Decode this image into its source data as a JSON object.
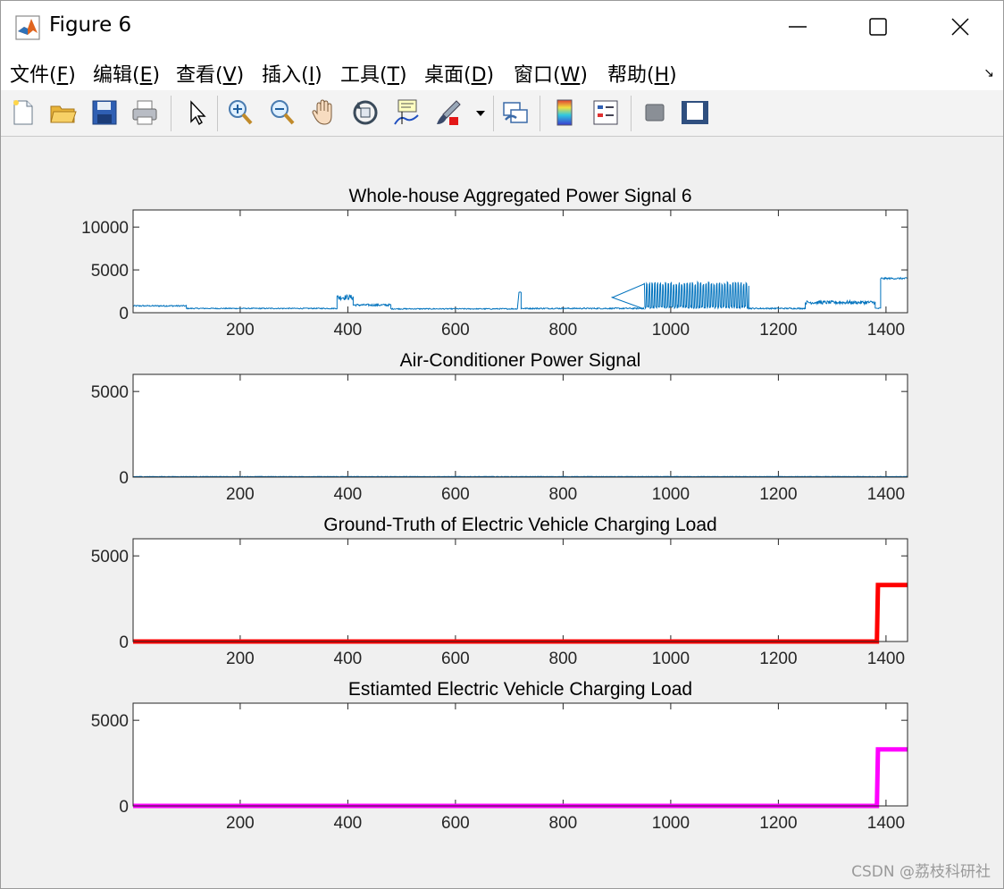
{
  "window": {
    "title": "Figure 6"
  },
  "menu": [
    {
      "label": "文件(",
      "key": "F",
      "tail": ")"
    },
    {
      "label": "编辑(",
      "key": "E",
      "tail": ")"
    },
    {
      "label": "查看(",
      "key": "V",
      "tail": ")"
    },
    {
      "label": "插入(",
      "key": "I",
      "tail": ")"
    },
    {
      "label": "工具(",
      "key": "T",
      "tail": ")"
    },
    {
      "label": "桌面(",
      "key": "D",
      "tail": ")"
    },
    {
      "label": "窗口(",
      "key": "W",
      "tail": ")"
    },
    {
      "label": "帮助(",
      "key": "H",
      "tail": ")"
    }
  ],
  "toolbar": {
    "icons": [
      "new-figure-icon",
      "open-file-icon",
      "save-icon",
      "print-icon",
      "select-arrow-icon",
      "zoom-in-icon",
      "zoom-out-icon",
      "pan-hand-icon",
      "rotate-3d-icon",
      "data-cursor-icon",
      "brush-icon",
      "brush-dropdown-icon",
      "link-plot-icon",
      "colorbar-icon",
      "legend-icon",
      "hide-plot-tools-icon",
      "show-plot-tools-icon"
    ]
  },
  "colors": {
    "aggregate": "#0072BD",
    "ac": "#0072BD",
    "ground_truth": "#FF0000",
    "estimated": "#FF00FF"
  },
  "watermark": "CSDN @荔枝科研社",
  "chart_data": [
    {
      "type": "line",
      "title": "Whole-house Aggregated Power Signal 6",
      "xlim": [
        1,
        1440
      ],
      "ylim": [
        0,
        12000
      ],
      "xticks": [
        200,
        400,
        600,
        800,
        1000,
        1200,
        1400
      ],
      "yticks": [
        0,
        5000,
        10000
      ],
      "series": [
        {
          "color": "#0072BD",
          "segments": [
            {
              "x": [
                1,
                100
              ],
              "base": 800,
              "noise": 150
            },
            {
              "x": [
                100,
                380
              ],
              "base": 500,
              "noise": 120
            },
            {
              "x": [
                380,
                410
              ],
              "base": 1800,
              "noise": 600
            },
            {
              "x": [
                410,
                480
              ],
              "base": 900,
              "noise": 250
            },
            {
              "x": [
                480,
                715
              ],
              "base": 450,
              "noise": 120
            },
            {
              "x": [
                718,
                722
              ],
              "base": 2400,
              "noise": 100
            },
            {
              "x": [
                722,
                950
              ],
              "base": 500,
              "noise": 150
            },
            {
              "x": [
                890,
                893
              ],
              "base": 1800,
              "noise": 100
            },
            {
              "x": [
                950,
                1145
              ],
              "base": 2500,
              "noise": 1000,
              "spiky": true
            },
            {
              "x": [
                1145,
                1250
              ],
              "base": 500,
              "noise": 150
            },
            {
              "x": [
                1250,
                1380
              ],
              "base": 1200,
              "noise": 400
            },
            {
              "x": [
                1380,
                1390
              ],
              "base": 500,
              "noise": 150
            },
            {
              "x": [
                1390,
                1440
              ],
              "base": 4000,
              "noise": 200
            }
          ]
        }
      ]
    },
    {
      "type": "line",
      "title": "Air-Conditioner Power Signal",
      "xlim": [
        1,
        1440
      ],
      "ylim": [
        0,
        6000
      ],
      "xticks": [
        200,
        400,
        600,
        800,
        1000,
        1200,
        1400
      ],
      "yticks": [
        0,
        5000
      ],
      "series": [
        {
          "color": "#0072BD",
          "segments": [
            {
              "x": [
                1,
                1440
              ],
              "base": 30,
              "noise": 25
            }
          ]
        }
      ]
    },
    {
      "type": "line",
      "title": "Ground-Truth of Electric Vehicle Charging Load",
      "xlim": [
        1,
        1440
      ],
      "ylim": [
        0,
        6000
      ],
      "xticks": [
        200,
        400,
        600,
        800,
        1000,
        1200,
        1400
      ],
      "yticks": [
        0,
        5000
      ],
      "series": [
        {
          "color": "#FF0000",
          "x": [
            1,
            1383,
            1385,
            1440
          ],
          "y": [
            0,
            0,
            3300,
            3300
          ]
        }
      ]
    },
    {
      "type": "line",
      "title": "Estiamted Electric Vehicle Charging Load",
      "xlim": [
        1,
        1440
      ],
      "ylim": [
        0,
        6000
      ],
      "xticks": [
        200,
        400,
        600,
        800,
        1000,
        1200,
        1400
      ],
      "yticks": [
        0,
        5000
      ],
      "series": [
        {
          "color": "#FF00FF",
          "x": [
            1,
            1383,
            1385,
            1440
          ],
          "y": [
            0,
            0,
            3300,
            3300
          ]
        }
      ]
    }
  ]
}
